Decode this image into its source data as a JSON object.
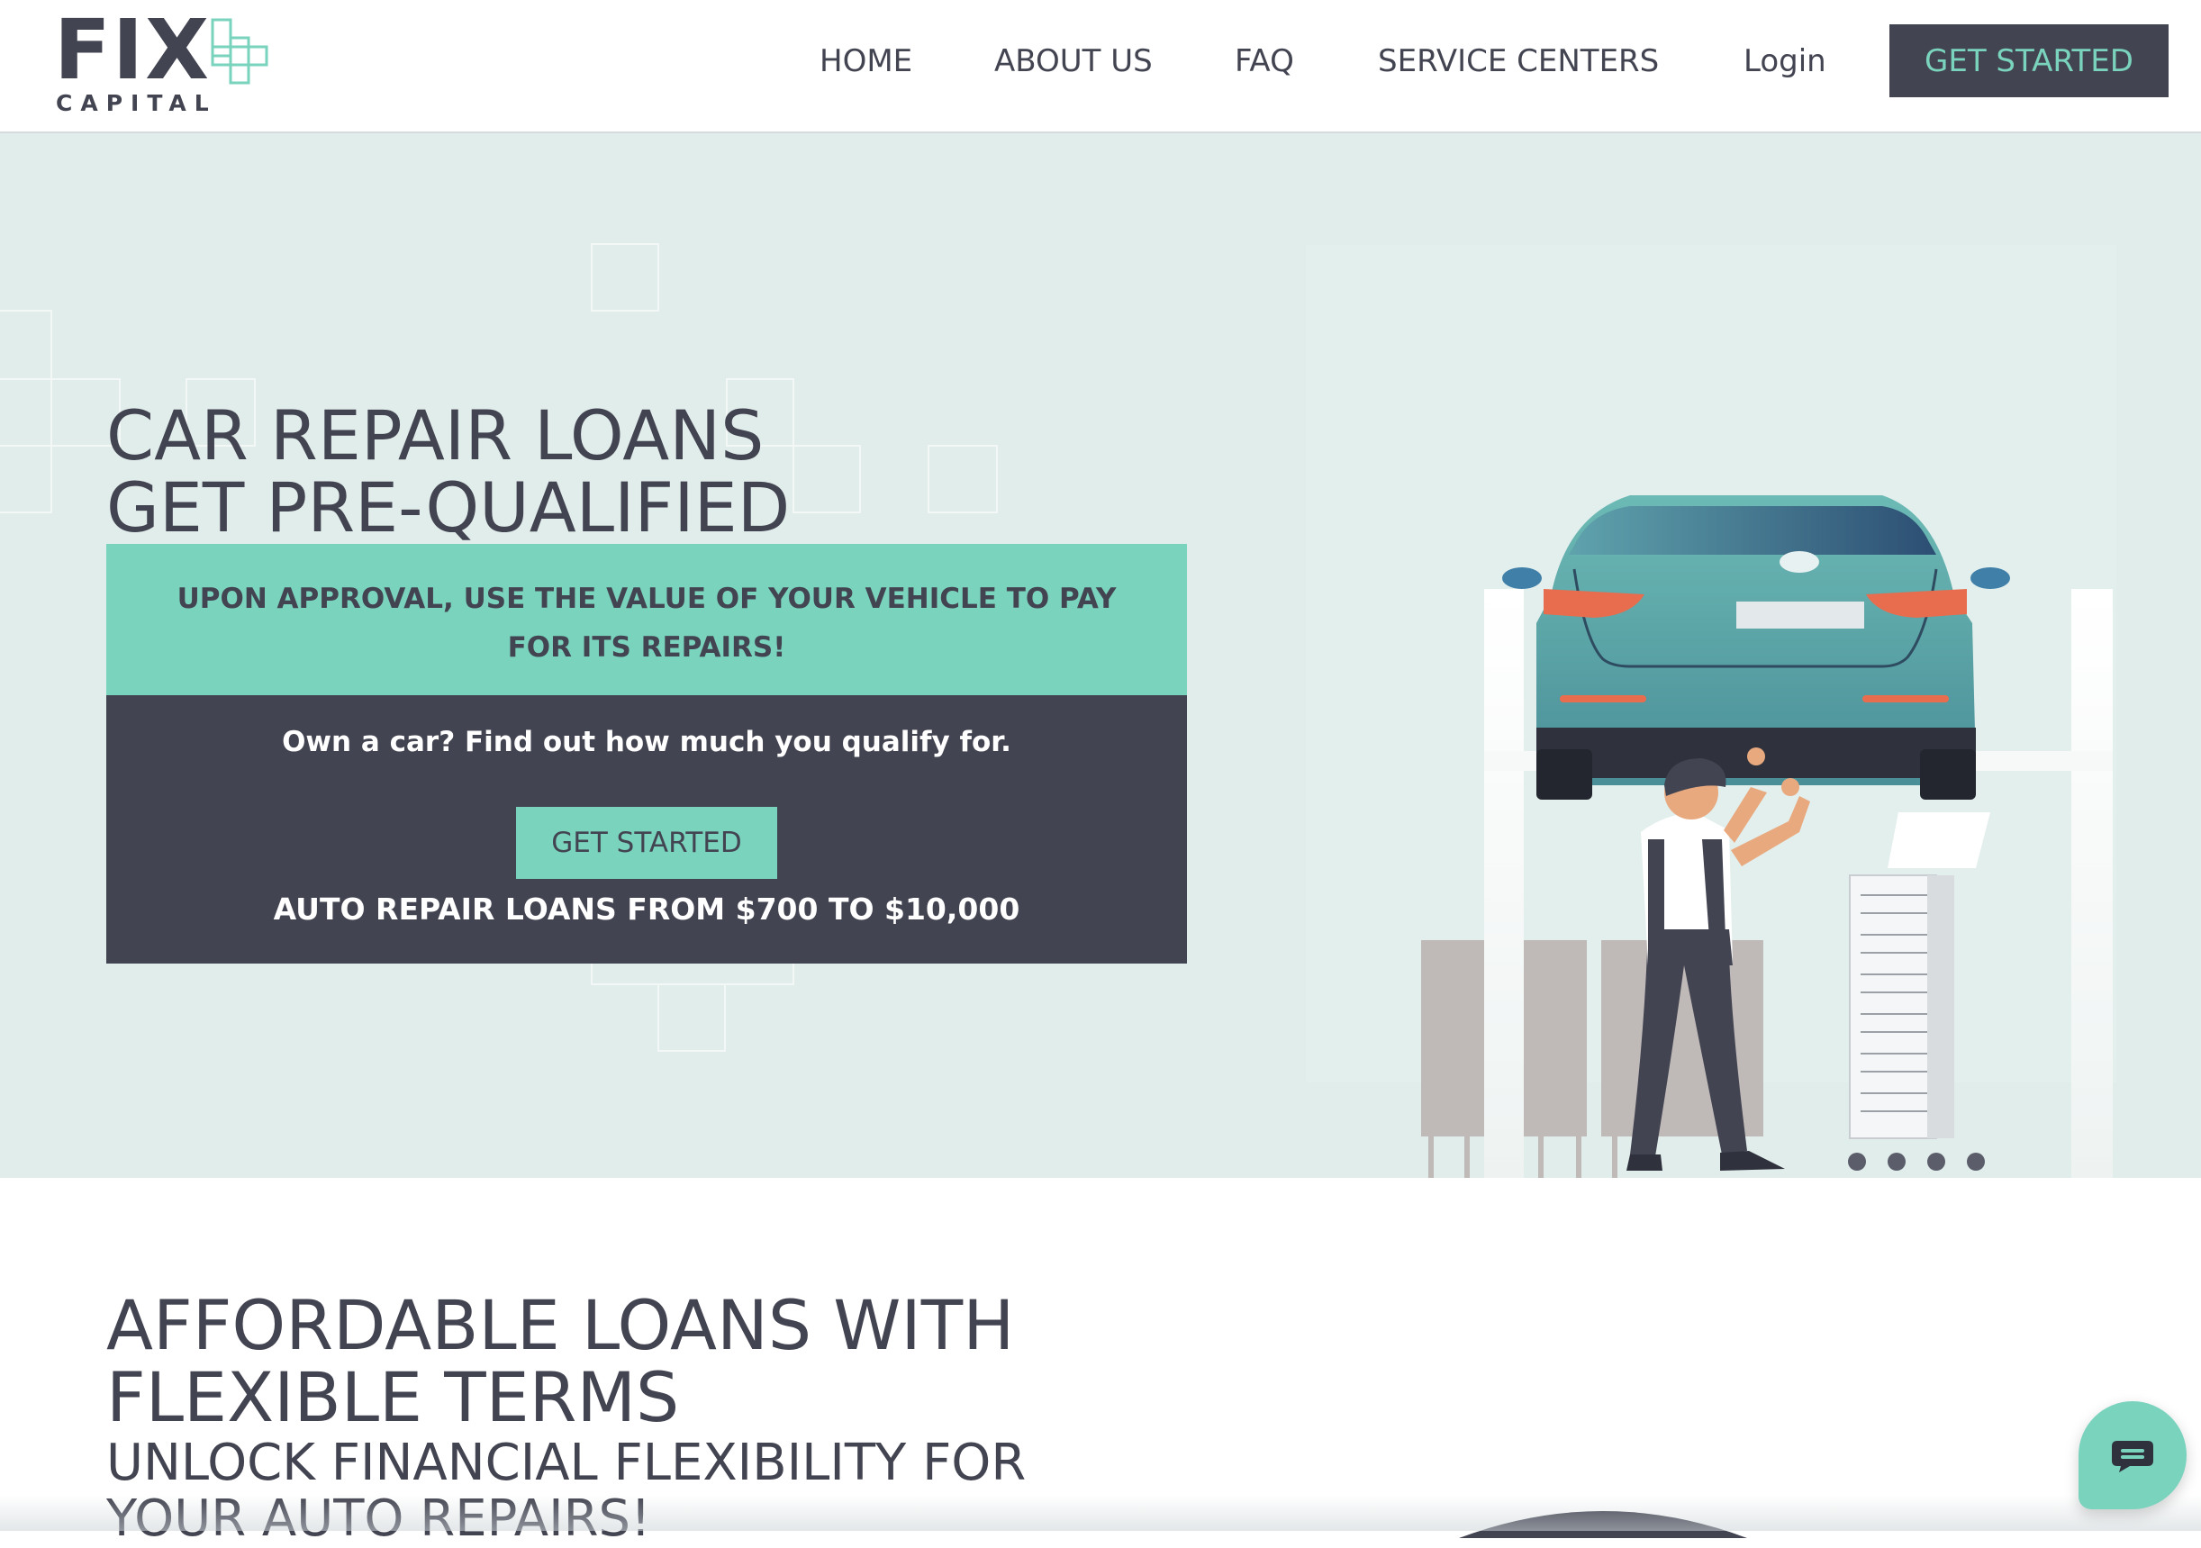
{
  "colors": {
    "accent": "#7ad3bd",
    "dark": "#434451",
    "hero_bg": "#e1edeb"
  },
  "header": {
    "logo": {
      "word": "FIX",
      "sub": "CAPITAL",
      "icon": "plus-cross-icon"
    },
    "nav": [
      {
        "label": "HOME"
      },
      {
        "label": "ABOUT US"
      },
      {
        "label": "FAQ"
      },
      {
        "label": "SERVICE CENTERS"
      },
      {
        "label": "Login"
      }
    ],
    "cta_label": "GET STARTED"
  },
  "hero": {
    "title_line1": "CAR REPAIR LOANS",
    "title_line2": "GET PRE-QUALIFIED",
    "banner_text": "UPON APPROVAL, USE THE VALUE OF YOUR VEHICLE TO PAY FOR ITS REPAIRS!",
    "question": "Own a car? Find out how much you qualify for.",
    "cta_label": "GET STARTED",
    "range_text": "AUTO REPAIR LOANS FROM $700 TO $10,000",
    "illustration": "mechanic-under-car-lift"
  },
  "section2": {
    "title_line1": "AFFORDABLE LOANS WITH",
    "title_line2": "FLEXIBLE TERMS",
    "subtitle_line1": "UNLOCK FINANCIAL FLEXIBILITY FOR",
    "subtitle_line2": "YOUR AUTO REPAIRS!"
  },
  "chat": {
    "icon": "chat-bubble-icon"
  }
}
